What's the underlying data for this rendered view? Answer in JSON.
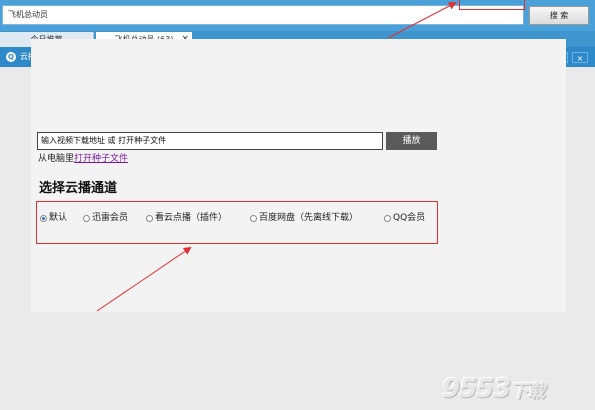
{
  "top_bar": {
    "search_value": "飞机总动员",
    "search_button": "搜 索"
  },
  "tabs": [
    {
      "label": "今日推荐"
    },
    {
      "label": "飞机总动员 (63)"
    }
  ],
  "tab_close_symbol": "×",
  "window": {
    "title": "云播放器",
    "icon_glyph": "Q",
    "minimize": "–",
    "maximize": "□",
    "close": "×"
  },
  "player": {
    "url_placeholder": "输入视频下载地址 或 打开种子文件",
    "play_button": "播放",
    "open_prefix": "从电脑里",
    "open_link": "打开种子文件"
  },
  "channels": {
    "title": "选择云播通道",
    "options": [
      {
        "label": "默认",
        "selected": true
      },
      {
        "label": "迅雷会员",
        "selected": false
      },
      {
        "label": "看云点播（插件）",
        "selected": false
      },
      {
        "label": "百度网盘（先离线下载）",
        "selected": false
      },
      {
        "label": "QQ会员",
        "selected": false
      }
    ]
  },
  "watermark": {
    "main": "9553",
    "suffix": "下载"
  },
  "colors": {
    "app_blue": "#4aa0d8",
    "title_blue": "#2e89c8",
    "highlight_red": "#e03030",
    "button_gray": "#5b5b5b",
    "link_purple": "#7a1aa0"
  }
}
